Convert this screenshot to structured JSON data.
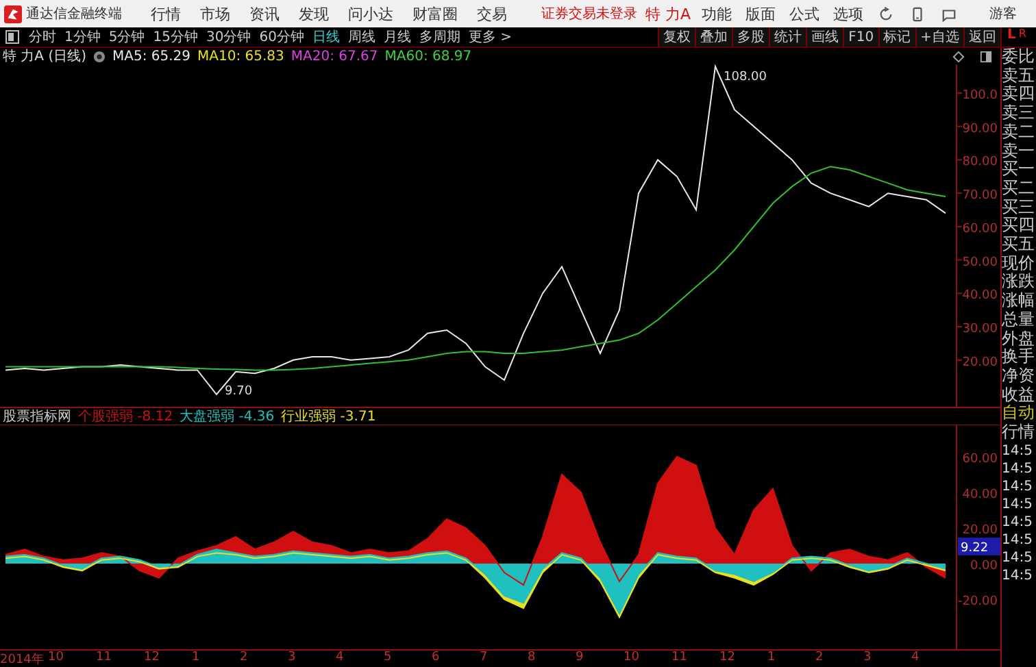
{
  "menu_bar": {
    "app_title": "通达信金融终端",
    "items": [
      "行情",
      "市场",
      "资讯",
      "发现",
      "问小达",
      "财富圈",
      "交易"
    ],
    "login_status": "证券交易未登录",
    "stock_name": "特 力A",
    "right_items": [
      "功能",
      "版面",
      "公式",
      "选项"
    ],
    "user": "游客"
  },
  "period_bar": {
    "periods": [
      {
        "label": "分时",
        "selected": false
      },
      {
        "label": "1分钟",
        "selected": false
      },
      {
        "label": "5分钟",
        "selected": false
      },
      {
        "label": "15分钟",
        "selected": false
      },
      {
        "label": "30分钟",
        "selected": false
      },
      {
        "label": "60分钟",
        "selected": false
      },
      {
        "label": "日线",
        "selected": true
      },
      {
        "label": "周线",
        "selected": false
      },
      {
        "label": "月线",
        "selected": false
      },
      {
        "label": "多周期",
        "selected": false
      },
      {
        "label": "更多 >",
        "selected": false
      }
    ],
    "tools": [
      "复权",
      "叠加",
      "多股",
      "统计",
      "画线",
      "F10",
      "标记",
      "+自选",
      "返回"
    ],
    "side_toggle": [
      "L",
      "R"
    ]
  },
  "chart_header": {
    "title": "特 力A (日线)",
    "ma_readings": [
      {
        "text": "MA5: 65.29",
        "color": "#e8e8e8"
      },
      {
        "text": "MA10: 65.83",
        "color": "#e8e020"
      },
      {
        "text": "MA20: 67.67",
        "color": "#e040e0"
      },
      {
        "text": "MA60: 68.97",
        "color": "#40d040"
      }
    ]
  },
  "price_chart": {
    "chart_data": {
      "type": "line",
      "ylim": [
        6,
        108.6
      ],
      "yticks": [
        {
          "value": 20,
          "label": "20.00"
        },
        {
          "value": 30,
          "label": "30.00"
        },
        {
          "value": 40,
          "label": "40.00"
        },
        {
          "value": 50,
          "label": "50.00"
        },
        {
          "value": 60,
          "label": "60.00"
        },
        {
          "value": 70,
          "label": "70.00"
        },
        {
          "value": 80,
          "label": "80.00"
        },
        {
          "value": 90,
          "label": "90.00"
        },
        {
          "value": 100,
          "label": "100.0"
        }
      ],
      "series": [
        {
          "color": "#e8e8e8",
          "values": [
            17,
            17.5,
            17,
            17.5,
            18,
            18,
            18.5,
            18,
            17.5,
            17,
            17,
            9.7,
            16.5,
            16,
            17.5,
            20,
            21,
            21,
            20,
            20.5,
            21,
            23,
            28,
            29,
            25,
            18,
            14,
            28,
            40,
            48,
            35,
            22,
            35,
            70,
            80,
            75,
            65,
            108,
            95,
            90,
            85,
            80,
            73,
            70,
            68,
            66,
            70,
            69,
            68,
            64
          ]
        },
        {
          "color": "#30c030",
          "values": [
            18,
            18,
            18,
            18,
            18,
            18,
            18,
            18,
            18,
            17.8,
            17.5,
            17.3,
            17.2,
            17,
            17,
            17.2,
            17.5,
            18,
            18.5,
            19,
            19.5,
            20,
            21,
            22,
            22.5,
            22.5,
            22,
            22,
            22.5,
            23,
            24,
            25,
            26,
            28,
            32,
            37,
            42,
            47,
            53,
            60,
            67,
            72,
            76,
            78,
            77,
            75,
            73,
            71,
            70,
            69
          ]
        }
      ],
      "annotations": [
        "108.00",
        "9.70"
      ]
    }
  },
  "order_panel": {
    "rows": [
      "委比",
      "卖五",
      "卖四",
      "卖三",
      "卖二",
      "卖一",
      "买一",
      "买二",
      "买三",
      "买四",
      "买五",
      "现价",
      "涨跌",
      "涨幅",
      "总量",
      "外盘",
      "换手",
      "净资",
      "收益"
    ],
    "mode": "自动",
    "tab": "行情",
    "ticks": [
      "14:5",
      "14:5",
      "14:5",
      "14:5",
      "14:5",
      "14:5",
      "14:5",
      "14:5"
    ]
  },
  "indicator": {
    "title": "股票指标网",
    "readings": [
      "-8.12",
      "-4.36",
      "-3.71"
    ],
    "cursor_value": "9.22",
    "chart_data": {
      "type": "area",
      "ylim": [
        -48,
        78
      ],
      "yticks": [
        {
          "value": 60,
          "label": "60.00"
        },
        {
          "value": 40,
          "label": "40.00"
        },
        {
          "value": 20,
          "label": "20.00"
        },
        {
          "value": 0,
          "label": "0.00"
        },
        {
          "value": -20,
          "label": "-20.00"
        }
      ],
      "series": [
        {
          "name": "个股强弱",
          "color": "#d01010",
          "values": [
            5,
            8,
            4,
            2,
            3,
            6,
            4,
            -4,
            -8,
            3,
            7,
            10,
            15,
            8,
            12,
            18,
            12,
            10,
            6,
            8,
            6,
            7,
            14,
            25,
            20,
            10,
            -5,
            -12,
            15,
            50,
            40,
            12,
            -10,
            5,
            45,
            60,
            55,
            20,
            5,
            30,
            42,
            10,
            -4,
            6,
            8,
            4,
            2,
            6,
            -2,
            -8
          ]
        },
        {
          "name": "大盘强弱",
          "color": "#20c0c0",
          "values": [
            4,
            5,
            3,
            -1,
            -3,
            3,
            4,
            2,
            -2,
            -1,
            5,
            8,
            6,
            4,
            5,
            7,
            6,
            5,
            4,
            5,
            3,
            4,
            6,
            7,
            3,
            -6,
            -18,
            -22,
            -3,
            6,
            3,
            -8,
            -28,
            -6,
            6,
            4,
            3,
            -4,
            -6,
            -10,
            -5,
            3,
            4,
            3,
            -1,
            -4,
            -2,
            3,
            0,
            -3
          ]
        },
        {
          "name": "行业强弱",
          "color": "#e8e020",
          "values": [
            3,
            4,
            2,
            -2,
            -4,
            2,
            3,
            1,
            -3,
            -2,
            4,
            6,
            5,
            3,
            4,
            6,
            5,
            4,
            3,
            4,
            2,
            3,
            5,
            6,
            2,
            -8,
            -20,
            -25,
            -5,
            5,
            2,
            -10,
            -30,
            -8,
            5,
            3,
            2,
            -5,
            -8,
            -12,
            -6,
            2,
            3,
            2,
            -2,
            -5,
            -3,
            2,
            -1,
            -4
          ]
        }
      ]
    }
  },
  "time_axis": [
    "2014年",
    "10",
    "11",
    "12",
    "1",
    "2",
    "3",
    "4",
    "5",
    "6",
    "7",
    "8",
    "9",
    "10",
    "11",
    "12",
    "1",
    "2",
    "3",
    "4"
  ]
}
